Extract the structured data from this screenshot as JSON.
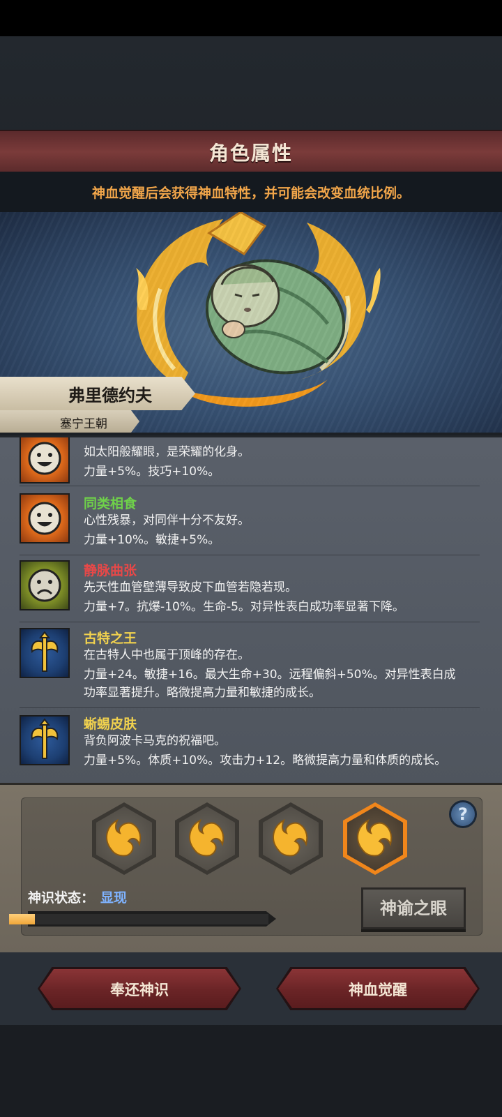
{
  "header": {
    "title": "角色属性",
    "subtitle": "神血觉醒后会获得神血特性，并可能会改变血统比例。"
  },
  "character": {
    "name": "弗里德约夫",
    "dynasty": "塞宁王朝"
  },
  "traits": [
    {
      "name": "",
      "name_color": "#6fd14a",
      "icon": "happy-face-icon",
      "lines": [
        "如太阳般耀眼，是荣耀的化身。",
        "力量+5%。技巧+10%。"
      ]
    },
    {
      "name": "同类相食",
      "name_color": "#6fd14a",
      "icon": "happy-face-icon",
      "lines": [
        "心性残暴，对同伴十分不友好。",
        "力量+10%。敏捷+5%。"
      ]
    },
    {
      "name": "静脉曲张",
      "name_color": "#e84848",
      "icon": "sad-face-icon",
      "lines": [
        "先天性血管壁薄导致皮下血管若隐若现。",
        "力量+7。抗爆-10%。生命-5。对异性表白成功率显著下降。"
      ]
    },
    {
      "name": "古特之王",
      "name_color": "#f2d24e",
      "icon": "axe-icon",
      "lines": [
        "在古特人中也属于顶峰的存在。",
        "力量+24。敏捷+16。最大生命+30。远程偏斜+50%。对异性表白成",
        "功率显著提升。略微提高力量和敏捷的成长。"
      ]
    },
    {
      "name": "蜥蜴皮肤",
      "name_color": "#f2d24e",
      "icon": "axe-icon",
      "lines": [
        "背负阿波卡马克的祝福吧。",
        "力量+5%。体质+10%。攻击力+12。略微提高力量和体质的成长。"
      ]
    }
  ],
  "divine": {
    "status_label": "神识状态：",
    "status_value": "显现",
    "progress": 0.1,
    "slots_total": 4,
    "active_slot": 4,
    "help_label": "?",
    "oracle_button": "神谕之眼"
  },
  "footer": {
    "return_button": "奉还神识",
    "awaken_button": "神血觉醒"
  },
  "colors": {
    "title_bar": "#6e3434",
    "subtitle_text": "#f2a64a",
    "progress_fill": "#f0a63a",
    "active_hex_border": "#f0861b"
  }
}
